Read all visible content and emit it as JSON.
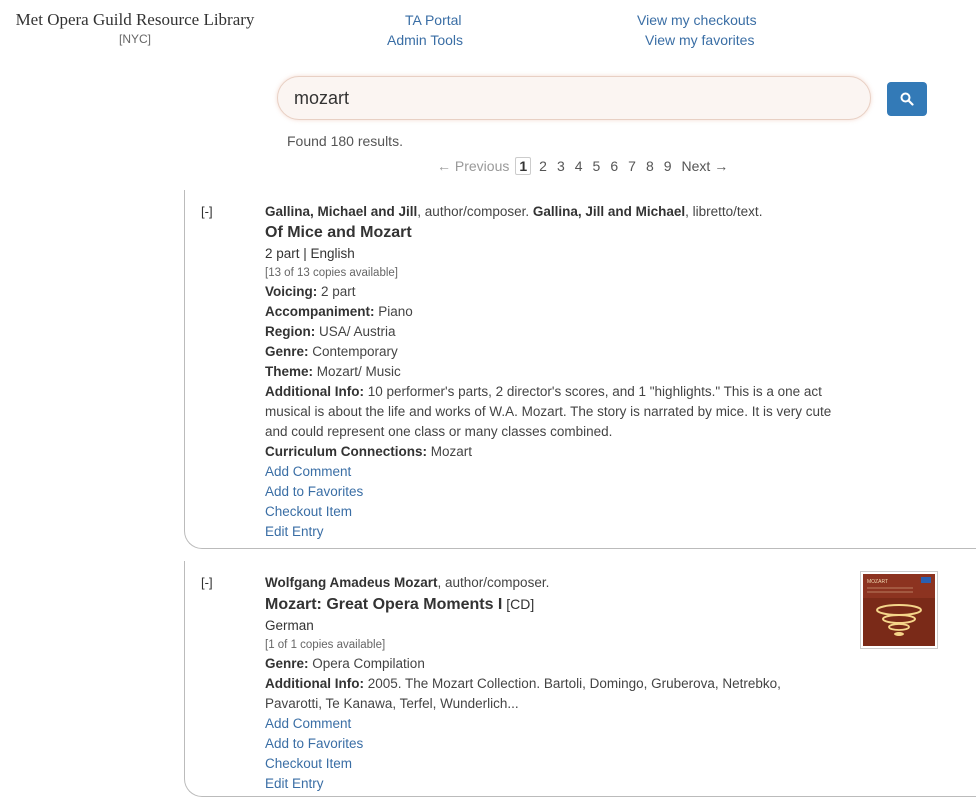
{
  "brand": {
    "title": "Met Opera Guild Resource Library",
    "location": "[NYC]"
  },
  "nav": {
    "ta_portal": "TA Portal",
    "admin_tools": "Admin Tools",
    "checkouts": "View my checkouts",
    "favorites": "View my favorites"
  },
  "search": {
    "query": "mozart",
    "found": "Found 180 results."
  },
  "pager": {
    "prev": "← Previous",
    "current": "1",
    "pages": [
      "2",
      "3",
      "4",
      "5",
      "6",
      "7",
      "8",
      "9"
    ],
    "next": "Next →"
  },
  "results": [
    {
      "toggle": "[-]",
      "credit1_name": "Gallina, Michael and Jill",
      "credit1_role": ", author/composer. ",
      "credit2_name": "Gallina, Jill and Michael",
      "credit2_role": ", libretto/text.",
      "title": "Of Mice and Mozart",
      "subline": "2 part | English",
      "copies": "[13 of 13 copies available]",
      "voicing_label": "Voicing:",
      "voicing": " 2 part",
      "accomp_label": "Accompaniment:",
      "accomp": " Piano",
      "region_label": "Region:",
      "region": " USA/ Austria",
      "genre_label": "Genre:",
      "genre": " Contemporary",
      "theme_label": "Theme:",
      "theme": " Mozart/ Music",
      "info_label": "Additional Info:",
      "info": " 10 performer's parts, 2 director's scores, and 1 \"highlights.\" This is a one act musical is about the life and works of W.A. Mozart. The story is narrated by mice. It is very cute and could represent one class or many classes combined.",
      "curr_label": "Curriculum Connections:",
      "curr": " Mozart",
      "links": {
        "comment": "Add Comment",
        "favorite": "Add to Favorites",
        "checkout": "Checkout Item",
        "edit": "Edit Entry"
      }
    },
    {
      "toggle": "[-]",
      "credit1_name": "Wolfgang Amadeus Mozart",
      "credit1_role": ", author/composer.",
      "title": "Mozart: Great Opera Moments I",
      "format": " [CD]",
      "subline": "German",
      "copies": "[1 of 1 copies available]",
      "genre_label": "Genre:",
      "genre": " Opera Compilation",
      "info_label": "Additional Info:",
      "info": " 2005. The Mozart Collection. Bartoli, Domingo, Gruberova, Netrebko, Pavarotti, Te Kanawa, Terfel, Wunderlich...",
      "cover_text": "MOZART",
      "links": {
        "comment": "Add Comment",
        "favorite": "Add to Favorites",
        "checkout": "Checkout Item",
        "edit": "Edit Entry"
      }
    }
  ]
}
